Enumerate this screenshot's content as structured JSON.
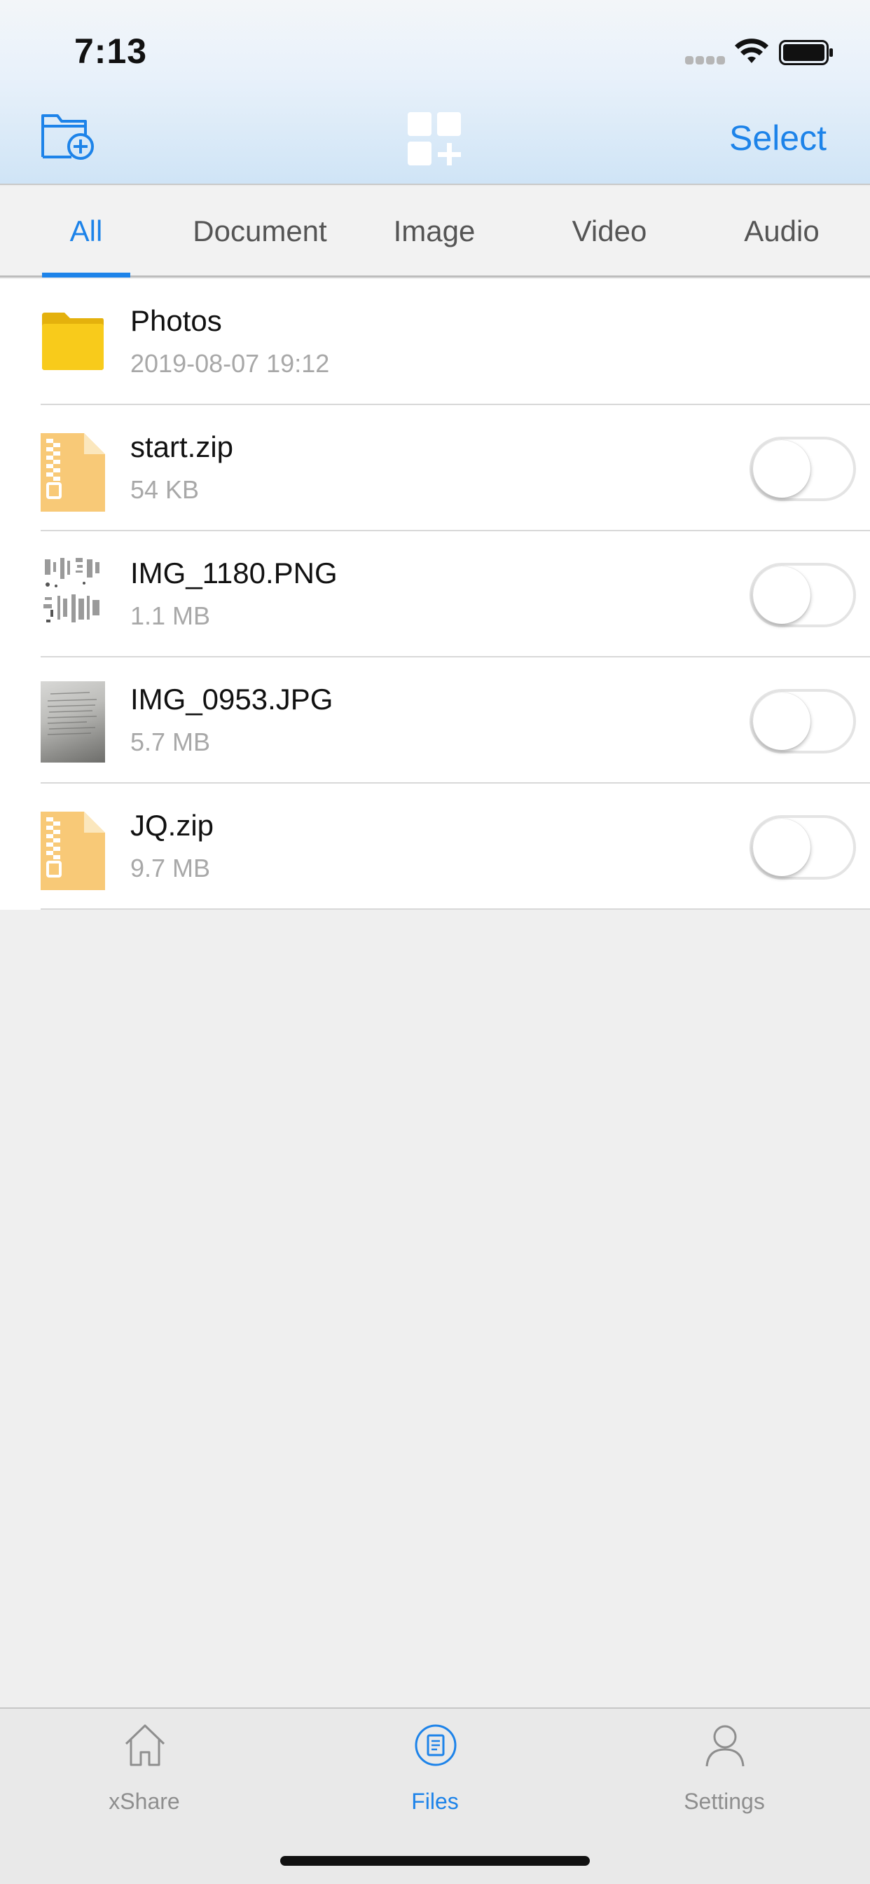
{
  "status_bar": {
    "time": "7:13",
    "icons": [
      "cellular-signal-icon",
      "wifi-icon",
      "battery-icon"
    ]
  },
  "nav": {
    "left_icon": "new-folder-icon",
    "center_icon": "grid-add-icon",
    "select_label": "Select",
    "accent_color": "#1d83e9"
  },
  "tabs": [
    {
      "label": "All",
      "active": true
    },
    {
      "label": "Document",
      "active": false
    },
    {
      "label": "Image",
      "active": false
    },
    {
      "label": "Video",
      "active": false
    },
    {
      "label": "Audio",
      "active": false
    }
  ],
  "files": [
    {
      "name": "Photos",
      "meta": "2019-08-07 19:12",
      "icon": "folder-icon",
      "toggle": null
    },
    {
      "name": "start.zip",
      "meta": "54 KB",
      "icon": "zip-file-icon",
      "toggle": false
    },
    {
      "name": "IMG_1180.PNG",
      "meta": "1.1 MB",
      "icon": "image-thumbnail",
      "toggle": false
    },
    {
      "name": "IMG_0953.JPG",
      "meta": "5.7 MB",
      "icon": "image-thumbnail",
      "toggle": false
    },
    {
      "name": "JQ.zip",
      "meta": "9.7 MB",
      "icon": "zip-file-icon",
      "toggle": false
    }
  ],
  "tabbar": [
    {
      "label": "xShare",
      "icon": "home-icon",
      "active": false
    },
    {
      "label": "Files",
      "icon": "files-icon",
      "active": true
    },
    {
      "label": "Settings",
      "icon": "person-icon",
      "active": false
    }
  ]
}
